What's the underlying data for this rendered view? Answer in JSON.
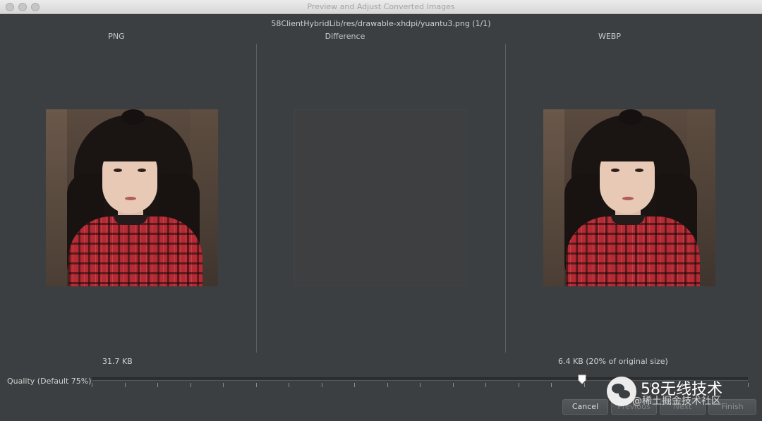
{
  "window": {
    "title": "Preview and Adjust Converted Images",
    "file_path": "58ClientHybridLib/res/drawable-xhdpi/yuantu3.png (1/1)"
  },
  "columns": {
    "png": "PNG",
    "difference": "Difference",
    "webp": "WEBP"
  },
  "sizes": {
    "png": "31.7 KB",
    "webp": "6.4 KB (20% of original size)"
  },
  "quality": {
    "label": "Quality (Default 75%)",
    "value_percent": 75
  },
  "buttons": {
    "cancel": "Cancel",
    "previous": "Previous",
    "next": "Next",
    "finish": "Finish"
  },
  "watermark": {
    "title": "58无线技术",
    "subtitle": "@稀土掘金技术社区"
  }
}
